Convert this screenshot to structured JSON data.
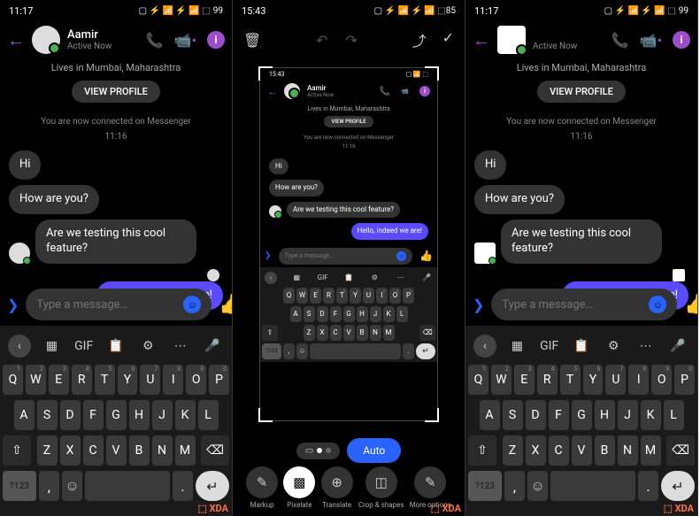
{
  "status": {
    "time1": "11:17",
    "time2": "15:43",
    "battery": "99"
  },
  "user": {
    "name": "Aamir",
    "status": "Active Now",
    "bio": "Lives in Mumbai, Maharashtra"
  },
  "profile_btn": "VIEW PROFILE",
  "connected": "You are now connected on Messenger",
  "ts": "11:16",
  "messages": [
    {
      "text": "Hi",
      "type": "received"
    },
    {
      "text": "How are you?",
      "type": "received"
    },
    {
      "text": "Are we testing this cool feature?",
      "type": "received"
    },
    {
      "text": "Hello, indeed we are!",
      "type": "sent"
    }
  ],
  "input_placeholder": "Type a message…",
  "keyboard": {
    "gif": "GIF",
    "row1": [
      "Q",
      "W",
      "E",
      "R",
      "T",
      "Y",
      "U",
      "I",
      "O",
      "P"
    ],
    "nums": [
      "1",
      "2",
      "3",
      "4",
      "5",
      "6",
      "7",
      "8",
      "9",
      "0"
    ],
    "row2": [
      "A",
      "S",
      "D",
      "F",
      "G",
      "H",
      "J",
      "K",
      "L"
    ],
    "row3": [
      "Z",
      "X",
      "C",
      "V",
      "B",
      "N",
      "M"
    ],
    "num_key": "?123"
  },
  "editor": {
    "auto": "Auto",
    "tools": [
      "Markup",
      "Pixelate",
      "Translate",
      "Crop &\nshapes",
      "More\noptions"
    ]
  },
  "watermark": "XDA"
}
